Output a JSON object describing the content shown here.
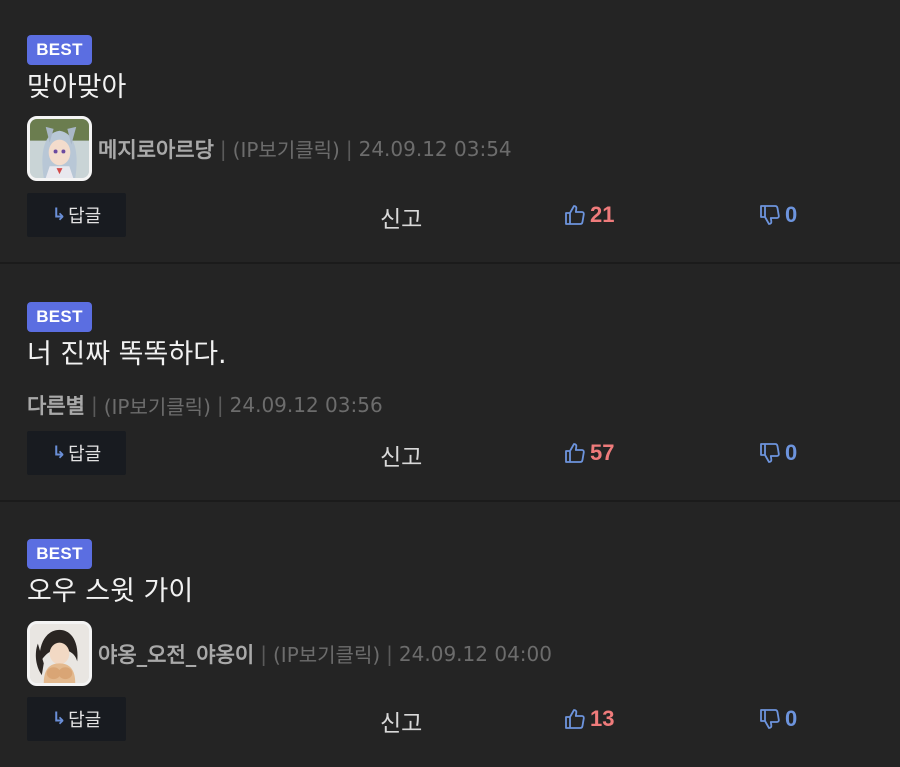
{
  "comments": [
    {
      "badge": "BEST",
      "text": "맞아맞아",
      "author": "메지로아르당",
      "ip_label": "(IP보기클릭)",
      "date": "24.09.12 03:54",
      "has_avatar": true,
      "reply_label": "답글",
      "report_label": "신고",
      "upvotes": "21",
      "downvotes": "0"
    },
    {
      "badge": "BEST",
      "text": "너 진짜 똑똑하다.",
      "author": "다른별",
      "ip_label": "(IP보기클릭)",
      "date": "24.09.12 03:56",
      "has_avatar": false,
      "reply_label": "답글",
      "report_label": "신고",
      "upvotes": "57",
      "downvotes": "0"
    },
    {
      "badge": "BEST",
      "text": "오우 스윗 가이",
      "author": "야옹_오전_야옹이",
      "ip_label": "(IP보기클릭)",
      "date": "24.09.12 04:00",
      "has_avatar": true,
      "reply_label": "답글",
      "report_label": "신고",
      "upvotes": "13",
      "downvotes": "0"
    }
  ],
  "icons": {
    "reply": "reply-arrow-icon",
    "upvote": "thumbs-up-icon",
    "downvote": "thumbs-down-icon"
  },
  "colors": {
    "background": "#242424",
    "badge": "#5b6ee1",
    "upvote_count": "#ef7b7b",
    "downvote_count": "#6d94dd",
    "reply_button": "#181b20"
  }
}
